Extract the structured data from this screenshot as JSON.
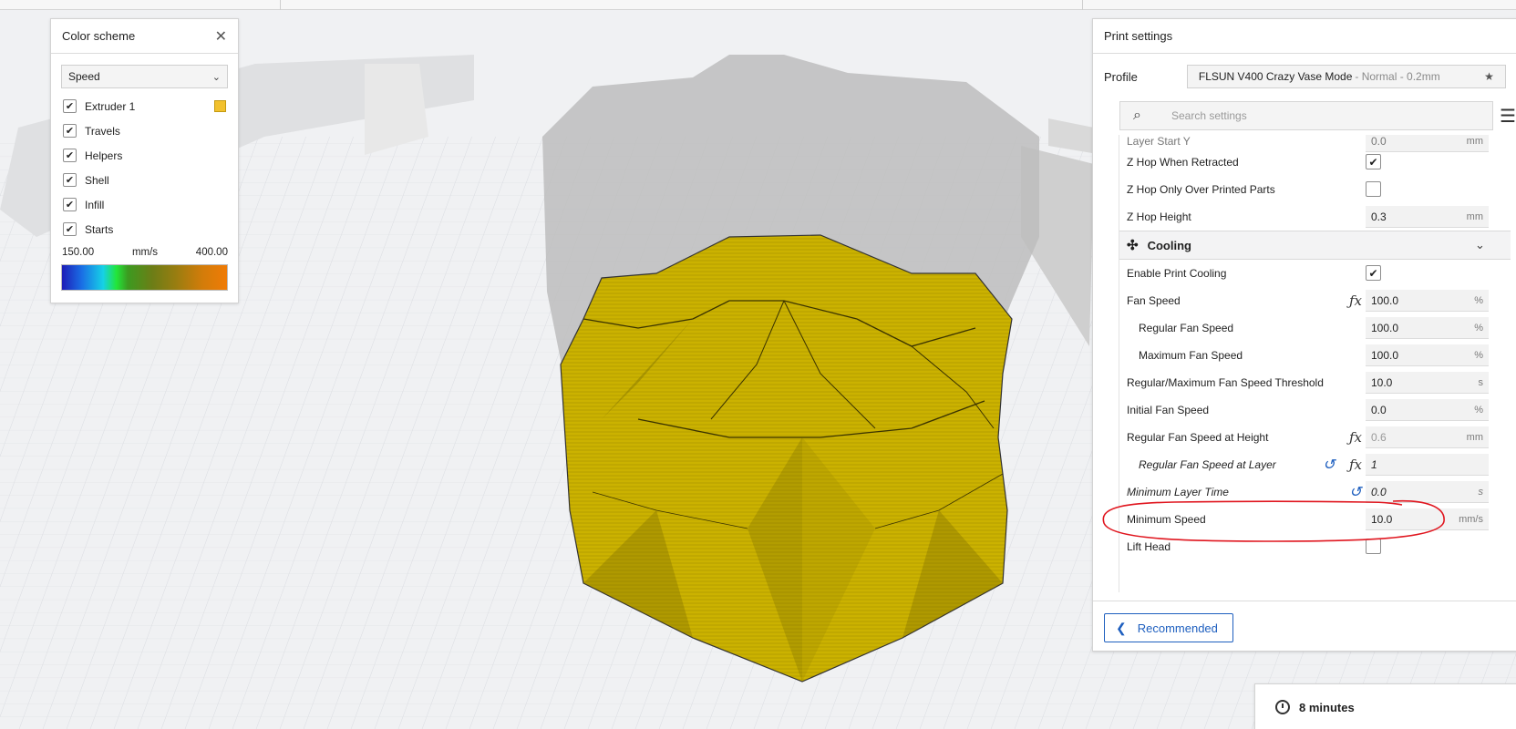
{
  "color_scheme": {
    "title": "Color scheme",
    "close_icon": "close-icon",
    "dropdown_value": "Speed",
    "items": [
      {
        "label": "Extruder 1",
        "checked": true,
        "swatch": "#f2c12e"
      },
      {
        "label": "Travels",
        "checked": true
      },
      {
        "label": "Helpers",
        "checked": true
      },
      {
        "label": "Shell",
        "checked": true
      },
      {
        "label": "Infill",
        "checked": true
      },
      {
        "label": "Starts",
        "checked": true
      }
    ],
    "range_min": "150.00",
    "range_unit": "mm/s",
    "range_max": "400.00"
  },
  "print_settings": {
    "title": "Print settings",
    "profile_label": "Profile",
    "profile_name": "FLSUN V400 Crazy Vase Mode",
    "profile_sub": "- Normal - 0.2mm",
    "search_placeholder": "Search settings",
    "rows": {
      "layer_start_partial": {
        "label": "Layer Start Y",
        "value": "0.0",
        "unit": "mm"
      },
      "z_hop_when_retracted": {
        "label": "Z Hop When Retracted",
        "checked": true
      },
      "z_hop_only_over_printed": {
        "label": "Z Hop Only Over Printed Parts",
        "checked": false
      },
      "z_hop_height": {
        "label": "Z Hop Height",
        "value": "0.3",
        "unit": "mm"
      },
      "cooling_category": {
        "label": "Cooling"
      },
      "enable_print_cooling": {
        "label": "Enable Print Cooling",
        "checked": true
      },
      "fan_speed": {
        "label": "Fan Speed",
        "value": "100.0",
        "unit": "%"
      },
      "regular_fan_speed": {
        "label": "Regular Fan Speed",
        "value": "100.0",
        "unit": "%"
      },
      "maximum_fan_speed": {
        "label": "Maximum Fan Speed",
        "value": "100.0",
        "unit": "%"
      },
      "fan_speed_threshold": {
        "label": "Regular/Maximum Fan Speed Threshold",
        "value": "10.0",
        "unit": "s"
      },
      "initial_fan_speed": {
        "label": "Initial Fan Speed",
        "value": "0.0",
        "unit": "%"
      },
      "regular_fan_speed_at_height": {
        "label": "Regular Fan Speed at Height",
        "value": "0.6",
        "unit": "mm"
      },
      "regular_fan_speed_at_layer": {
        "label": "Regular Fan Speed at Layer",
        "value": "1",
        "unit": ""
      },
      "minimum_layer_time": {
        "label": "Minimum Layer Time",
        "value": "0.0",
        "unit": "s"
      },
      "minimum_speed": {
        "label": "Minimum Speed",
        "value": "10.0",
        "unit": "mm/s"
      },
      "lift_head": {
        "label": "Lift Head",
        "checked": false
      }
    },
    "recommended_button": "Recommended"
  },
  "estimate": {
    "time": "8 minutes"
  },
  "colors": {
    "accent": "#1e5fbf",
    "model_yellow": "#c9b100",
    "annotation_red": "#e0161f"
  }
}
